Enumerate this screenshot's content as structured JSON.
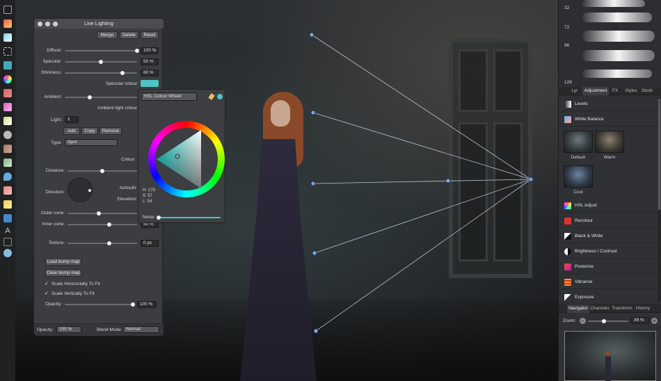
{
  "panel": {
    "title": "Live Lighting",
    "buttons": {
      "merge": "Merge",
      "delete": "Delete",
      "reset": "Reset"
    },
    "diffuse": {
      "label": "Diffuse:",
      "value": "100 %",
      "level": 1.0
    },
    "specular": {
      "label": "Specular:",
      "value": "50 %",
      "level": 0.5
    },
    "shininess": {
      "label": "Shininess:",
      "value": "80 %",
      "level": 0.8
    },
    "specular_colour_label": "Specular colour:",
    "specular_colour": "#4fc3c3",
    "ambient_label": "Ambient:",
    "ambient_level": 0.35,
    "ambient_light_colour_label": "Ambient light colour:",
    "light_label": "Light:",
    "light_value": "1",
    "light_buttons": {
      "add": "Add",
      "copy": "Copy",
      "remove": "Remove"
    },
    "type_label": "Type:",
    "type_value": "Spot",
    "colour_label": "Colour:",
    "distance_label": "Distance:",
    "distance_level": 0.5,
    "direction_label": "Direction:",
    "azimuth_label": "Azimuth:",
    "elevation_label": "Elevation:",
    "outer_cone_label": "Outer cone:",
    "outer_cone_level": 0.45,
    "inner_cone_label": "Inner cone:",
    "inner_cone_value": "50 %",
    "inner_cone_level": 0.6,
    "texture_label": "Texture:",
    "texture_value": "0 px",
    "texture_level": 0.6,
    "load_bump_map": "Load bump map",
    "clear_bump_map": "Clear bump map",
    "scale_h": "Scale Horizontally To Fit",
    "scale_v": "Scale Vertically To Fit",
    "opacity_label": "Opacity:",
    "opacity_value": "100 %",
    "opacity_level": 1.0,
    "footer": {
      "opacity_label": "Opacity:",
      "opacity_value": "100 %",
      "blend_label": "Blend Mode:",
      "blend_value": "Normal"
    }
  },
  "colour_popup": {
    "mode": "HSL Colour Wheel",
    "h": "H: 179",
    "s": "S: 57",
    "l": "L: 54",
    "noise_label": "Noise"
  },
  "right_panel": {
    "brush_sizes": [
      "32",
      "72",
      "96",
      "128"
    ],
    "tabs": [
      "Lyr",
      "Adjustment",
      "FX",
      "Styles",
      "Stock"
    ],
    "active_tab": "Adjustment",
    "adjustments_top": [
      "Levels",
      "White Balance"
    ],
    "presets": [
      "Default",
      "Warm",
      "Cool"
    ],
    "adjustments": [
      "HSL Adjust",
      "Recolour",
      "Black & White",
      "Brightness / Contrast",
      "Posterise",
      "Vibrance",
      "Exposure"
    ],
    "bottom_tabs": [
      "Navigator",
      "Channels",
      "Transform",
      "History"
    ],
    "active_bottom_tab": "Navigator",
    "zoom_label": "Zoom:",
    "zoom_value": "39 %",
    "zoom_level": 0.39
  },
  "colors": {
    "accent_lines": "#d0dff0",
    "panel_bg": "#3b3d40"
  }
}
